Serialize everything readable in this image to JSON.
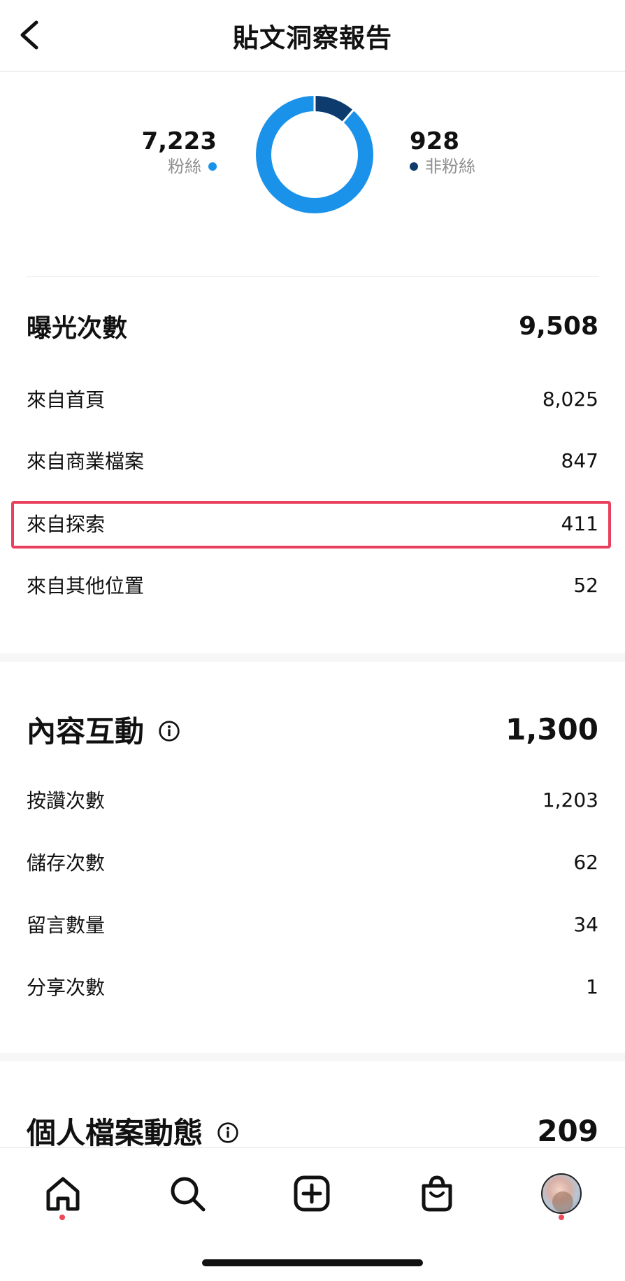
{
  "header": {
    "title": "貼文洞察報告"
  },
  "audience": {
    "followers": {
      "value": "7,223",
      "label": "粉絲",
      "color": "#1a92ea"
    },
    "non_followers": {
      "value": "928",
      "label": "非粉絲",
      "color": "#0d3b6e"
    },
    "follower_fraction": 0.886
  },
  "impressions": {
    "title": "曝光次數",
    "total": "9,508",
    "rows": [
      {
        "label": "來自首頁",
        "value": "8,025"
      },
      {
        "label": "來自商業檔案",
        "value": "847"
      },
      {
        "label": "來自探索",
        "value": "411",
        "highlighted": true
      },
      {
        "label": "來自其他位置",
        "value": "52"
      }
    ]
  },
  "interactions": {
    "title": "內容互動",
    "total": "1,300",
    "rows": [
      {
        "label": "按讚次數",
        "value": "1,203"
      },
      {
        "label": "儲存次數",
        "value": "62"
      },
      {
        "label": "留言數量",
        "value": "34"
      },
      {
        "label": "分享次數",
        "value": "1"
      }
    ]
  },
  "profile_activity": {
    "title": "個人檔案動態",
    "total": "209"
  },
  "nav": {
    "items": [
      "home-icon",
      "search-icon",
      "create-icon",
      "shop-icon",
      "profile-avatar"
    ]
  },
  "colors": {
    "accent_red": "#e8405d",
    "notification_dot": "#ed4956"
  }
}
